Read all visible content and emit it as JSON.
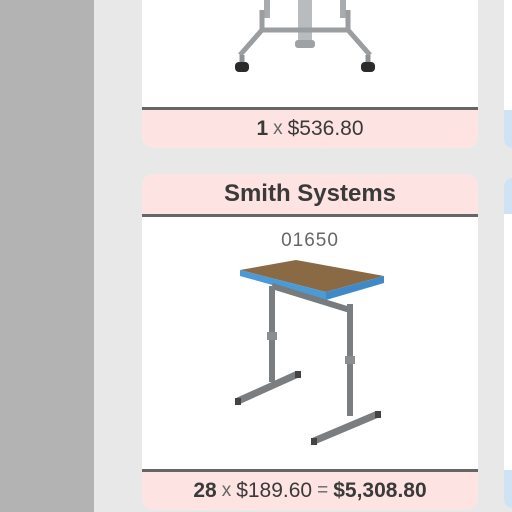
{
  "products": [
    {
      "quantity": "1",
      "times_symbol": "x",
      "unit_price": "$536.80",
      "image_icon": "mobile-stand-base-image"
    },
    {
      "brand": "Smith Systems",
      "sku": "01650",
      "quantity": "28",
      "times_symbol": "x",
      "unit_price": "$189.60",
      "equals_symbol": "=",
      "total": "$5,308.80",
      "image_icon": "student-desk-image"
    }
  ],
  "colors": {
    "header_footer_bg": "#fde3e1",
    "neighbor_card_accent": "#cfe3f5",
    "rail": "#b3b3b3",
    "page_bg": "#e8e8e8"
  }
}
